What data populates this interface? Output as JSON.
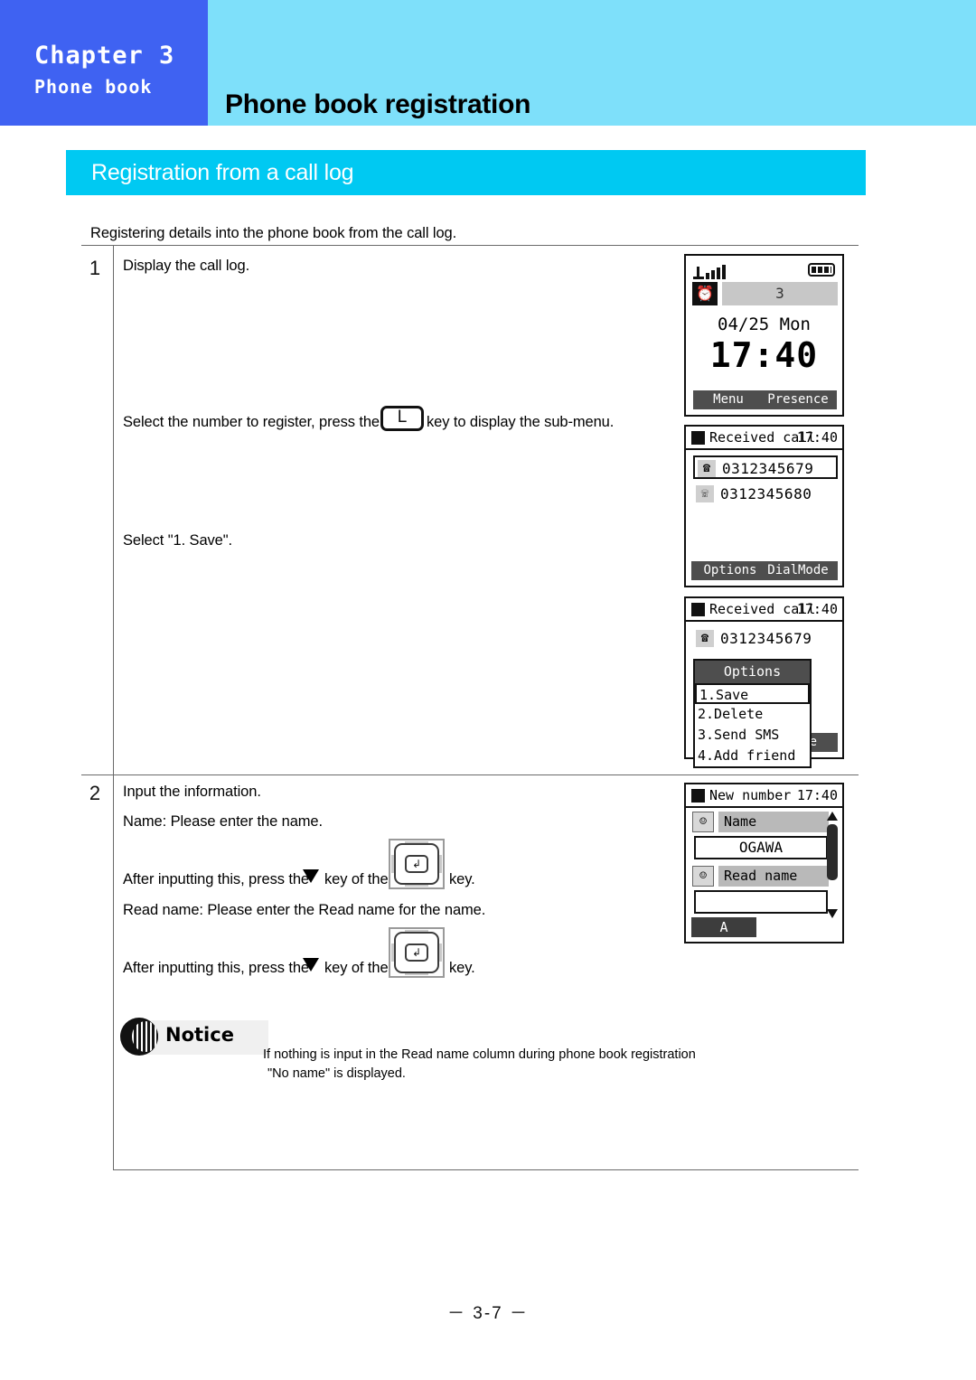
{
  "header": {
    "chapter": "Chapter 3",
    "chapter_sub": "Phone book",
    "title": "Phone book registration",
    "chapter_bg": "#3F62F2",
    "band_bg": "#7EE0FA"
  },
  "section": {
    "title": "Registration from a call log",
    "bg": "#00C9F2"
  },
  "intro": "Registering details into the phone book from the call log.",
  "steps": {
    "one": {
      "number": "1",
      "line1": "Display the call log.",
      "line2a": "Select the number to register, press the",
      "key_glyph": "L",
      "line2b": "key to display the sub-menu.",
      "line3": "Select \"1. Save\"."
    },
    "two": {
      "number": "2",
      "line1": "Input the information.",
      "line2": "Name:  Please enter the name.",
      "line3a": "After inputting this, press the",
      "line3b": "key of the",
      "line3c": "key.",
      "line4": "Read name:  Please enter the Read name for the name.",
      "line5a": "After inputting this, press the",
      "line5b": "key of the",
      "line5c": "key.",
      "enter_glyph": "↲"
    }
  },
  "notice": {
    "label": "Notice",
    "text1": "If nothing is input in the Read name column during phone book registration",
    "text2": "\"No name\" is displayed."
  },
  "footer": "－ 3-7 －",
  "screens": {
    "standby": {
      "count": "3",
      "date": "04/25 Mon",
      "time": "17:40",
      "softkey_left": "Menu",
      "softkey_right": "Presence"
    },
    "call_log": {
      "title": "Received call",
      "time": "17:40",
      "entries": [
        {
          "number": "0312345679",
          "icon": "incoming-call-icon",
          "selected": true
        },
        {
          "number": "0312345680",
          "icon": "missed-call-icon",
          "selected": false
        }
      ],
      "softkey_left": "Options",
      "softkey_right": "DialMode"
    },
    "options_menu": {
      "title": "Received call",
      "time": "17:40",
      "entry": "0312345679",
      "popup_title": "Options",
      "items": [
        {
          "label": "1.Save",
          "selected": true
        },
        {
          "label": "2.Delete",
          "selected": false
        },
        {
          "label": "3.Send SMS",
          "selected": false
        },
        {
          "label": "4.Add friend",
          "selected": false
        }
      ],
      "softkey_right_partial": "lMode"
    },
    "new_number": {
      "title": "New number",
      "time": "17:40",
      "name_label": "Name",
      "name_value": "OGAWA",
      "read_name_label": "Read name",
      "read_name_value": "",
      "ime_mode": "A"
    }
  }
}
